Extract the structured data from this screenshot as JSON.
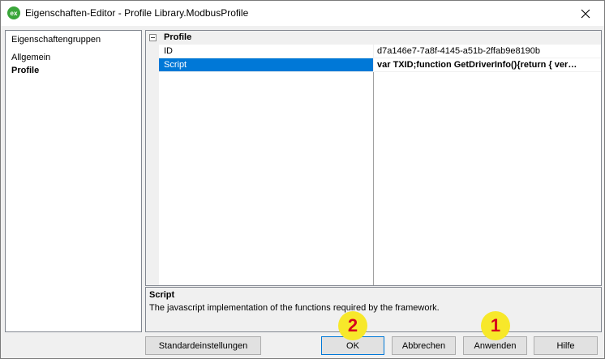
{
  "window": {
    "title": "Eigenschaften-Editor - Profile Library.ModbusProfile",
    "app_icon_text": "ex"
  },
  "sidebar": {
    "items": [
      {
        "label": "Eigenschaftengruppen"
      },
      {
        "label": "Allgemein"
      },
      {
        "label": "Profile"
      }
    ]
  },
  "grid": {
    "category": "Profile",
    "rows": [
      {
        "name": "ID",
        "value": "d7a146e7-7a8f-4145-a51b-2ffab9e8190b"
      },
      {
        "name": "Script",
        "value": "var TXID;function GetDriverInfo(){return { ver…"
      }
    ]
  },
  "description": {
    "title": "Script",
    "text": "The javascript implementation of the functions required by the framework."
  },
  "buttons": {
    "defaults": "Standardeinstellungen",
    "ok": "OK",
    "cancel": "Abbrechen",
    "apply": "Anwenden",
    "help": "Hilfe"
  },
  "badges": {
    "ok_badge": "2",
    "apply_badge": "1"
  },
  "colors": {
    "selection": "#0078d7",
    "badge_fill": "#f7e82a",
    "badge_text": "#d6001c",
    "app_icon": "#3aa63a"
  }
}
